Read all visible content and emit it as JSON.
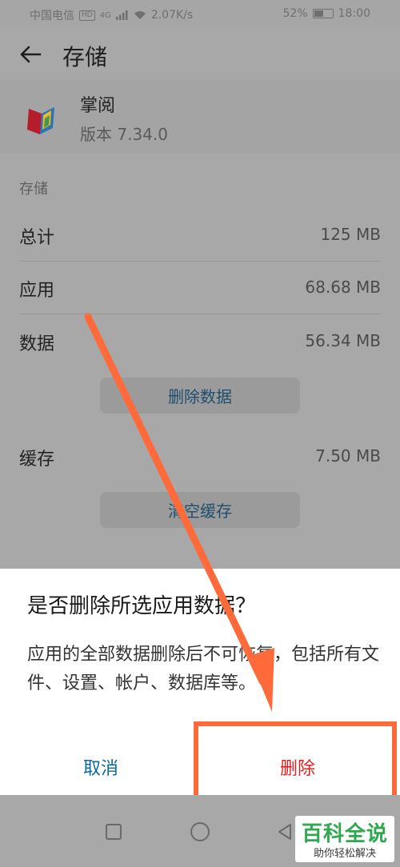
{
  "status_bar": {
    "carrier": "中国电信",
    "network_badge": "HD",
    "network_type": "4G",
    "speed": "2.07K/s",
    "battery_percent": "52%",
    "battery_level": 0.52,
    "time": "18:00"
  },
  "header": {
    "title": "存储",
    "back_icon": "arrow-left-icon"
  },
  "app": {
    "name": "掌阅",
    "version": "版本 7.34.0"
  },
  "storage": {
    "section_label": "存储",
    "rows": [
      {
        "label": "总计",
        "value": "125 MB"
      },
      {
        "label": "应用",
        "value": "68.68 MB"
      },
      {
        "label": "数据",
        "value": "56.34 MB"
      }
    ],
    "delete_data_button": "删除数据",
    "cache": {
      "label": "缓存",
      "value": "7.50 MB"
    },
    "clear_cache_button": "清空缓存"
  },
  "dialog": {
    "title": "是否删除所选应用数据？",
    "message": "应用的全部数据删除后不可恢复，包括所有文件、设置、帐户、数据库等。",
    "cancel_label": "取消",
    "delete_label": "删除"
  },
  "annotation": {
    "arrow_color": "#ff6a3a",
    "highlight_color": "#ff6a3a"
  },
  "watermark": {
    "top": "百科全说",
    "bottom": "助你轻松解决"
  }
}
